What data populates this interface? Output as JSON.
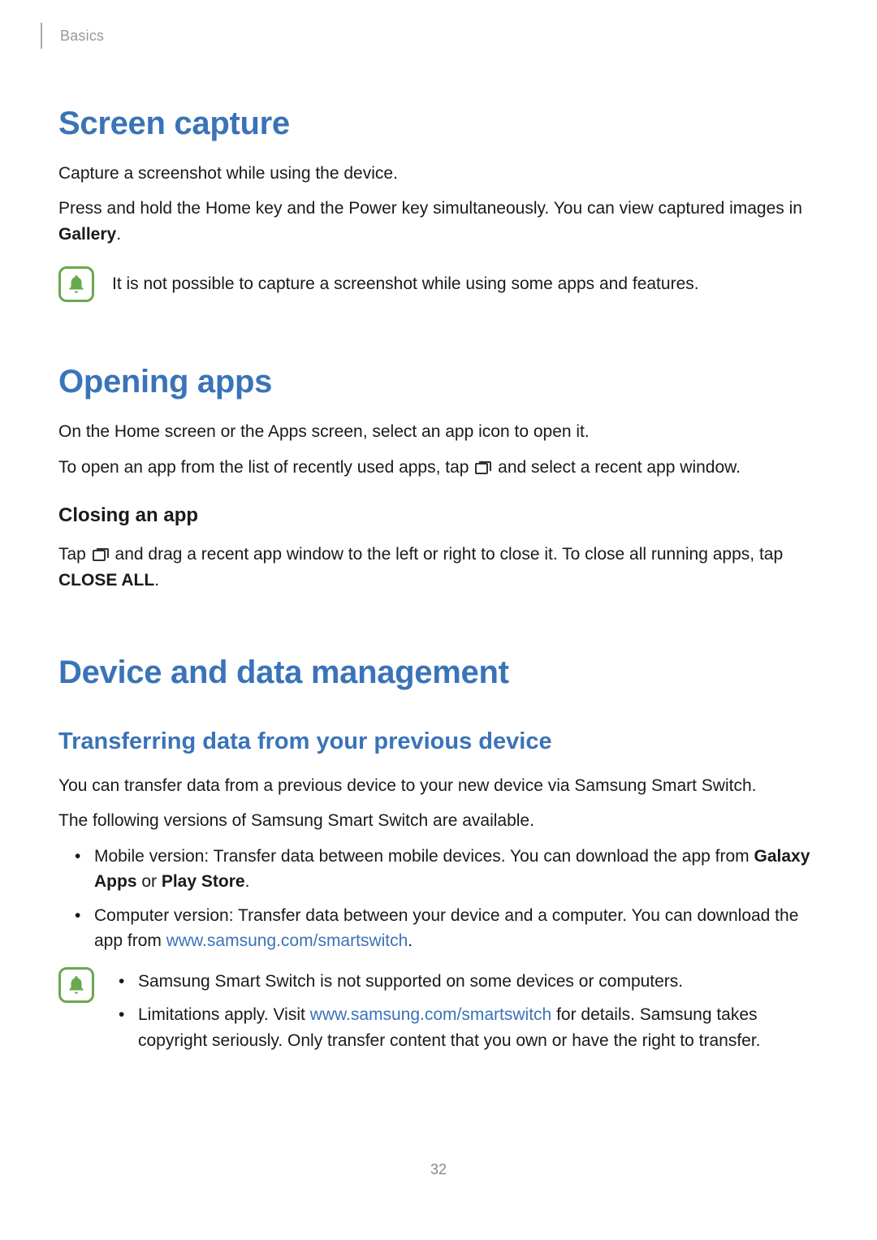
{
  "header": {
    "breadcrumb": "Basics"
  },
  "screen_capture": {
    "title": "Screen capture",
    "p1": "Capture a screenshot while using the device.",
    "p2_before": "Press and hold the Home key and the Power key simultaneously. You can view captured images in ",
    "p2_bold": "Gallery",
    "p2_after": ".",
    "note": "It is not possible to capture a screenshot while using some apps and features."
  },
  "opening_apps": {
    "title": "Opening apps",
    "p1": "On the Home screen or the Apps screen, select an app icon to open it.",
    "p2_before": "To open an app from the list of recently used apps, tap ",
    "p2_after": " and select a recent app window.",
    "closing_title": "Closing an app",
    "p3_before": "Tap ",
    "p3_mid": " and drag a recent app window to the left or right to close it. To close all running apps, tap ",
    "p3_bold": "CLOSE ALL",
    "p3_after": "."
  },
  "device_data": {
    "title": "Device and data management",
    "subtitle": "Transferring data from your previous device",
    "p1": "You can transfer data from a previous device to your new device via Samsung Smart Switch.",
    "p2": "The following versions of Samsung Smart Switch are available.",
    "bullet1_before": "Mobile version: Transfer data between mobile devices. You can download the app from ",
    "bullet1_bold1": "Galaxy Apps",
    "bullet1_mid": " or ",
    "bullet1_bold2": "Play Store",
    "bullet1_after": ".",
    "bullet2_before": "Computer version: Transfer data between your device and a computer. You can download the app from ",
    "bullet2_link": "www.samsung.com/smartswitch",
    "bullet2_after": ".",
    "note1": "Samsung Smart Switch is not supported on some devices or computers.",
    "note2_before": "Limitations apply. Visit ",
    "note2_link": "www.samsung.com/smartswitch",
    "note2_after": " for details. Samsung takes copyright seriously. Only transfer content that you own or have the right to transfer."
  },
  "page_number": "32"
}
